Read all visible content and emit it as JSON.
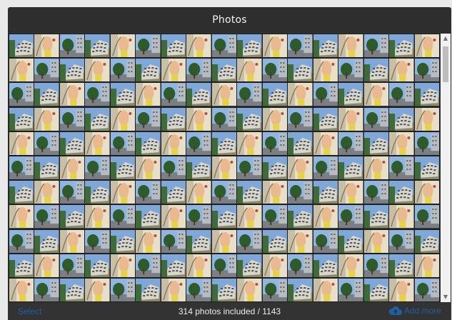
{
  "window": {
    "title": "Photos"
  },
  "gallery": {
    "columns": 17,
    "visible_rows": 11,
    "thumbnail_pattern": [
      "building-photo",
      "street-art-photo",
      "tree-photo"
    ]
  },
  "footer": {
    "select_label": "Select",
    "count_text": "314 photos included / 1143",
    "add_more_label": "Add more",
    "add_more_icon": "cloud-upload-icon"
  },
  "scrollbar": {
    "up_icon": "scroll-up-arrow-icon",
    "down_icon": "scroll-down-arrow-icon"
  },
  "colors": {
    "title_bar_bg": "#2e2e2e",
    "footer_bg": "#333333",
    "link_blue": "#1e5fa8"
  }
}
